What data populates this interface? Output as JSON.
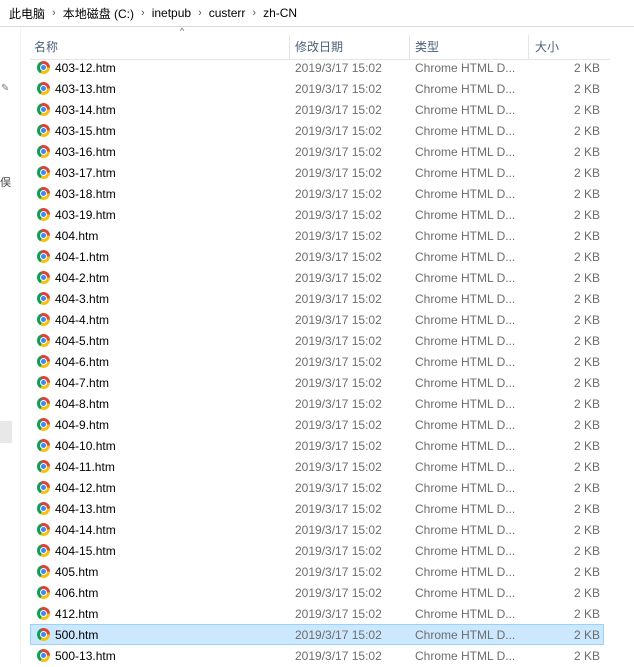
{
  "breadcrumb": [
    "此电脑",
    "本地磁盘 (C:)",
    "inetpub",
    "custerr",
    "zh-CN"
  ],
  "left_pane": {
    "fragment": "俣"
  },
  "columns": {
    "name": "名称",
    "date": "修改日期",
    "type": "类型",
    "size": "大小"
  },
  "files": [
    {
      "name": "403-12.htm",
      "date": "2019/3/17 15:02",
      "type": "Chrome HTML D...",
      "size": "2 KB"
    },
    {
      "name": "403-13.htm",
      "date": "2019/3/17 15:02",
      "type": "Chrome HTML D...",
      "size": "2 KB"
    },
    {
      "name": "403-14.htm",
      "date": "2019/3/17 15:02",
      "type": "Chrome HTML D...",
      "size": "2 KB"
    },
    {
      "name": "403-15.htm",
      "date": "2019/3/17 15:02",
      "type": "Chrome HTML D...",
      "size": "2 KB"
    },
    {
      "name": "403-16.htm",
      "date": "2019/3/17 15:02",
      "type": "Chrome HTML D...",
      "size": "2 KB"
    },
    {
      "name": "403-17.htm",
      "date": "2019/3/17 15:02",
      "type": "Chrome HTML D...",
      "size": "2 KB"
    },
    {
      "name": "403-18.htm",
      "date": "2019/3/17 15:02",
      "type": "Chrome HTML D...",
      "size": "2 KB"
    },
    {
      "name": "403-19.htm",
      "date": "2019/3/17 15:02",
      "type": "Chrome HTML D...",
      "size": "2 KB"
    },
    {
      "name": "404.htm",
      "date": "2019/3/17 15:02",
      "type": "Chrome HTML D...",
      "size": "2 KB"
    },
    {
      "name": "404-1.htm",
      "date": "2019/3/17 15:02",
      "type": "Chrome HTML D...",
      "size": "2 KB"
    },
    {
      "name": "404-2.htm",
      "date": "2019/3/17 15:02",
      "type": "Chrome HTML D...",
      "size": "2 KB"
    },
    {
      "name": "404-3.htm",
      "date": "2019/3/17 15:02",
      "type": "Chrome HTML D...",
      "size": "2 KB"
    },
    {
      "name": "404-4.htm",
      "date": "2019/3/17 15:02",
      "type": "Chrome HTML D...",
      "size": "2 KB"
    },
    {
      "name": "404-5.htm",
      "date": "2019/3/17 15:02",
      "type": "Chrome HTML D...",
      "size": "2 KB"
    },
    {
      "name": "404-6.htm",
      "date": "2019/3/17 15:02",
      "type": "Chrome HTML D...",
      "size": "2 KB"
    },
    {
      "name": "404-7.htm",
      "date": "2019/3/17 15:02",
      "type": "Chrome HTML D...",
      "size": "2 KB"
    },
    {
      "name": "404-8.htm",
      "date": "2019/3/17 15:02",
      "type": "Chrome HTML D...",
      "size": "2 KB"
    },
    {
      "name": "404-9.htm",
      "date": "2019/3/17 15:02",
      "type": "Chrome HTML D...",
      "size": "2 KB"
    },
    {
      "name": "404-10.htm",
      "date": "2019/3/17 15:02",
      "type": "Chrome HTML D...",
      "size": "2 KB"
    },
    {
      "name": "404-11.htm",
      "date": "2019/3/17 15:02",
      "type": "Chrome HTML D...",
      "size": "2 KB"
    },
    {
      "name": "404-12.htm",
      "date": "2019/3/17 15:02",
      "type": "Chrome HTML D...",
      "size": "2 KB"
    },
    {
      "name": "404-13.htm",
      "date": "2019/3/17 15:02",
      "type": "Chrome HTML D...",
      "size": "2 KB"
    },
    {
      "name": "404-14.htm",
      "date": "2019/3/17 15:02",
      "type": "Chrome HTML D...",
      "size": "2 KB"
    },
    {
      "name": "404-15.htm",
      "date": "2019/3/17 15:02",
      "type": "Chrome HTML D...",
      "size": "2 KB"
    },
    {
      "name": "405.htm",
      "date": "2019/3/17 15:02",
      "type": "Chrome HTML D...",
      "size": "2 KB"
    },
    {
      "name": "406.htm",
      "date": "2019/3/17 15:02",
      "type": "Chrome HTML D...",
      "size": "2 KB"
    },
    {
      "name": "412.htm",
      "date": "2019/3/17 15:02",
      "type": "Chrome HTML D...",
      "size": "2 KB"
    },
    {
      "name": "500.htm",
      "date": "2019/3/17 15:02",
      "type": "Chrome HTML D...",
      "size": "2 KB",
      "selected": true
    },
    {
      "name": "500-13.htm",
      "date": "2019/3/17 15:02",
      "type": "Chrome HTML D...",
      "size": "2 KB"
    }
  ],
  "file_icon": "chrome-icon",
  "colors": {
    "selection_bg": "#cce8ff",
    "selection_border": "#99d1ff",
    "header_text": "#4c607a",
    "meta_text": "#6d6d6d"
  }
}
